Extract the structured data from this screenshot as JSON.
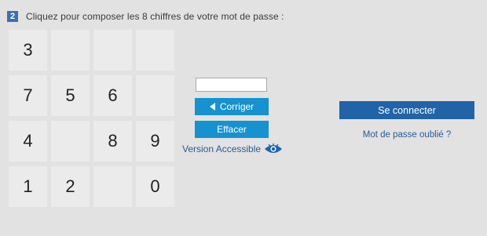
{
  "step": {
    "number": "2",
    "instruction": "Cliquez pour composer les 8 chiffres de votre mot de passe :"
  },
  "keypad": {
    "keys": [
      "3",
      "",
      "",
      "",
      "7",
      "5",
      "6",
      "",
      "4",
      "",
      "8",
      "9",
      "1",
      "2",
      "",
      "0"
    ]
  },
  "password_field": {
    "value": ""
  },
  "buttons": {
    "corriger_label": "Corriger",
    "effacer_label": "Effacer",
    "connect_label": "Se connecter"
  },
  "links": {
    "accessible_label": "Version Accessible",
    "forgot_label": "Mot de passe oublié ?"
  },
  "icons": {
    "corriger": "triangle-left-icon",
    "accessible": "eye-icon"
  },
  "colors": {
    "background": "#e2e2e2",
    "key_background": "#ebebeb",
    "action_blue": "#1592cf",
    "connect_blue": "#2063a8",
    "link_blue": "#2a5a93",
    "step_badge": "#3c6fb0"
  }
}
